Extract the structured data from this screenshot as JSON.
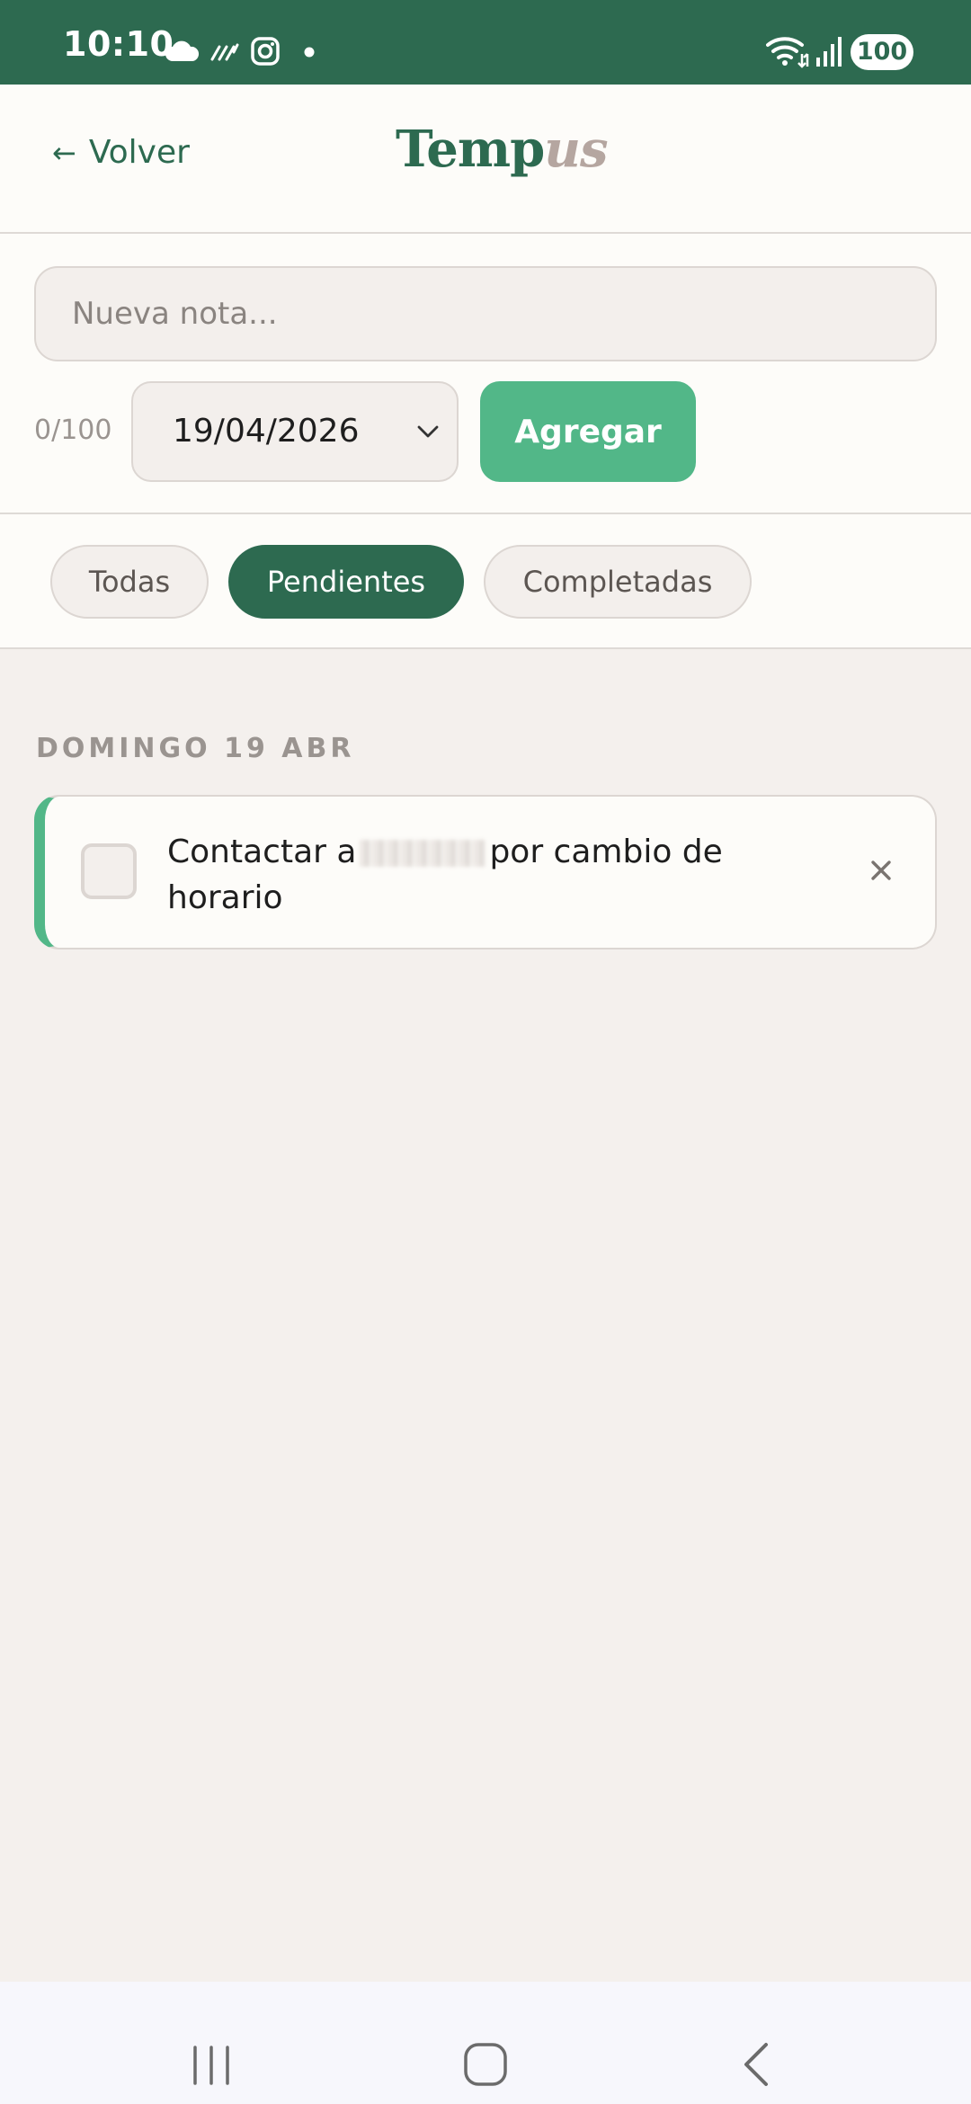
{
  "status_bar": {
    "time": "10:10",
    "battery": "100",
    "icons": [
      "cloud-icon",
      "haze-icon",
      "instagram-icon",
      "dot-icon",
      "wifi-icon",
      "signal-icon",
      "battery-icon"
    ]
  },
  "header": {
    "back_label": "Volver",
    "back_arrow": "←",
    "logo_part1": "Temp",
    "logo_part2": "us"
  },
  "form": {
    "note_placeholder": "Nueva nota...",
    "note_value": "",
    "char_count": "0/100",
    "date_value": "19/04/2026",
    "add_label": "Agregar"
  },
  "filters": {
    "items": [
      {
        "label": "Todas",
        "active": false
      },
      {
        "label": "Pendientes",
        "active": true
      },
      {
        "label": "Completadas",
        "active": false
      }
    ]
  },
  "groups": [
    {
      "header": "DOMINGO 19 ABR",
      "tasks": [
        {
          "text_before": "Contactar a",
          "text_after": "por cambio de horario",
          "completed": false
        }
      ]
    }
  ],
  "colors": {
    "primary": "#2d6a50",
    "accent": "#52b788",
    "background": "#f4f0ed",
    "surface": "#fdfcf9"
  }
}
